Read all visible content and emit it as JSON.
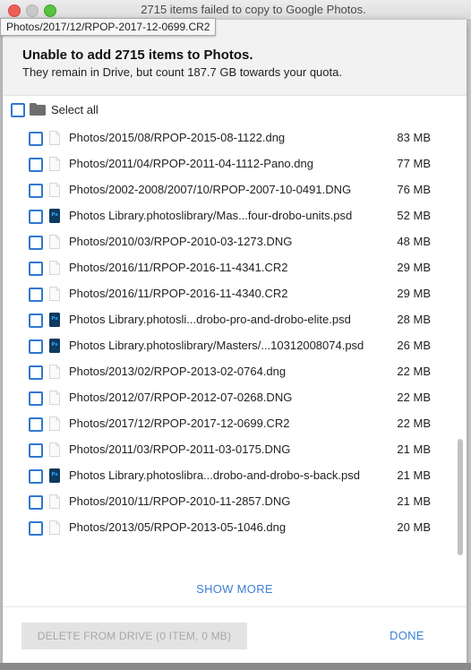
{
  "window": {
    "title": "2715 items failed to copy to Google Photos.",
    "tooltip": "Photos/2017/12/RPOP-2017-12-0699.CR2"
  },
  "dialog": {
    "title": "Unable to add 2715 items to Photos.",
    "subtitle": "They remain in Drive, but count 187.7 GB towards your quota.",
    "select_all_label": "Select all",
    "files": [
      {
        "name": "Photos/2015/08/RPOP-2015-08-1122.dng",
        "size": "83 MB",
        "icon": "file-icon"
      },
      {
        "name": "Photos/2011/04/RPOP-2011-04-1112-Pano.dng",
        "size": "77 MB",
        "icon": "file-icon"
      },
      {
        "name": "Photos/2002-2008/2007/10/RPOP-2007-10-0491.DNG",
        "size": "76 MB",
        "icon": "file-icon"
      },
      {
        "name": "Photos Library.photoslibrary/Mas...four-drobo-units.psd",
        "size": "52 MB",
        "icon": "psd-icon"
      },
      {
        "name": "Photos/2010/03/RPOP-2010-03-1273.DNG",
        "size": "48 MB",
        "icon": "file-icon"
      },
      {
        "name": "Photos/2016/11/RPOP-2016-11-4341.CR2",
        "size": "29 MB",
        "icon": "file-icon"
      },
      {
        "name": "Photos/2016/11/RPOP-2016-11-4340.CR2",
        "size": "29 MB",
        "icon": "file-icon"
      },
      {
        "name": "Photos Library.photosli...drobo-pro-and-drobo-elite.psd",
        "size": "28 MB",
        "icon": "psd-icon"
      },
      {
        "name": "Photos Library.photoslibrary/Masters/...10312008074.psd",
        "size": "26 MB",
        "icon": "psd-icon"
      },
      {
        "name": "Photos/2013/02/RPOP-2013-02-0764.dng",
        "size": "22 MB",
        "icon": "file-icon"
      },
      {
        "name": "Photos/2012/07/RPOP-2012-07-0268.DNG",
        "size": "22 MB",
        "icon": "file-icon"
      },
      {
        "name": "Photos/2017/12/RPOP-2017-12-0699.CR2",
        "size": "22 MB",
        "icon": "file-icon"
      },
      {
        "name": "Photos/2011/03/RPOP-2011-03-0175.DNG",
        "size": "21 MB",
        "icon": "file-icon"
      },
      {
        "name": "Photos Library.photoslibra...drobo-and-drobo-s-back.psd",
        "size": "21 MB",
        "icon": "psd-icon"
      },
      {
        "name": "Photos/2010/11/RPOP-2010-11-2857.DNG",
        "size": "21 MB",
        "icon": "file-icon"
      },
      {
        "name": "Photos/2013/05/RPOP-2013-05-1046.dng",
        "size": "20 MB",
        "icon": "file-icon"
      }
    ],
    "show_more_label": "SHOW MORE",
    "delete_button_label": "DELETE FROM DRIVE (0 ITEM, 0 MB)",
    "done_button_label": "DONE"
  },
  "colors": {
    "accent": "#3078d0",
    "link": "#3c7fd4",
    "psd_icon": "#0d3a5f"
  }
}
